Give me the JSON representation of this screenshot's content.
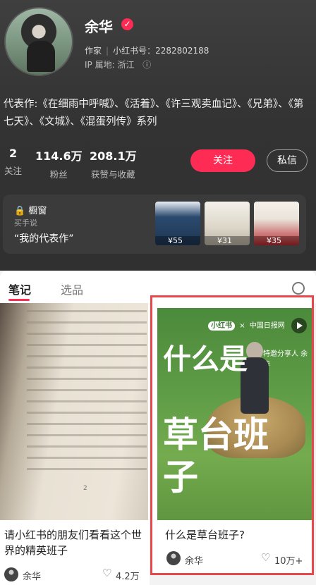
{
  "profile": {
    "name": "余华",
    "title": "作家",
    "redbook_id": "小红书号：2282802188",
    "ip": "IP 属地: 浙江",
    "info_icon": "ⓘ",
    "bio": "代表作:《在细雨中呼喊》、《活着》、《许三观卖血记》、《兄弟》、《第七天》、《文城》、《混蛋列传》系列"
  },
  "stats": [
    {
      "value": "2",
      "label": "关注"
    },
    {
      "value": "114.6万",
      "label": "粉丝"
    },
    {
      "value": "208.1万",
      "label": "获赞与收藏"
    }
  ],
  "buttons": {
    "follow": "关注",
    "message": "私信"
  },
  "shop": {
    "title": "橱窗",
    "buyer_says": "买手说",
    "quote": "“我的代表作”",
    "products": [
      {
        "price": "¥55",
        "color": "#2b4a6e"
      },
      {
        "price": "¥31",
        "color": "#dcd6c8"
      },
      {
        "price": "¥35",
        "color": "#b8262c"
      }
    ]
  },
  "tabs": {
    "notes": "笔记",
    "selected": "选品"
  },
  "notes": [
    {
      "title": "请小红书的朋友们看看这个世界的精英班子",
      "user": "余华",
      "likes": "4.2万",
      "book_page_num": "2"
    },
    {
      "title": "什么是草台班子?",
      "user": "余华",
      "likes": "10万+",
      "cover_logo_1": "小红书",
      "cover_logo_2": "中国日报网",
      "cover_guest": "特邀分享人 余华",
      "cover_title_1": "什么是",
      "cover_title_2": "草台班子"
    }
  ],
  "colors": {
    "accent": "#fe2c55",
    "highlight": "#e8474c"
  }
}
